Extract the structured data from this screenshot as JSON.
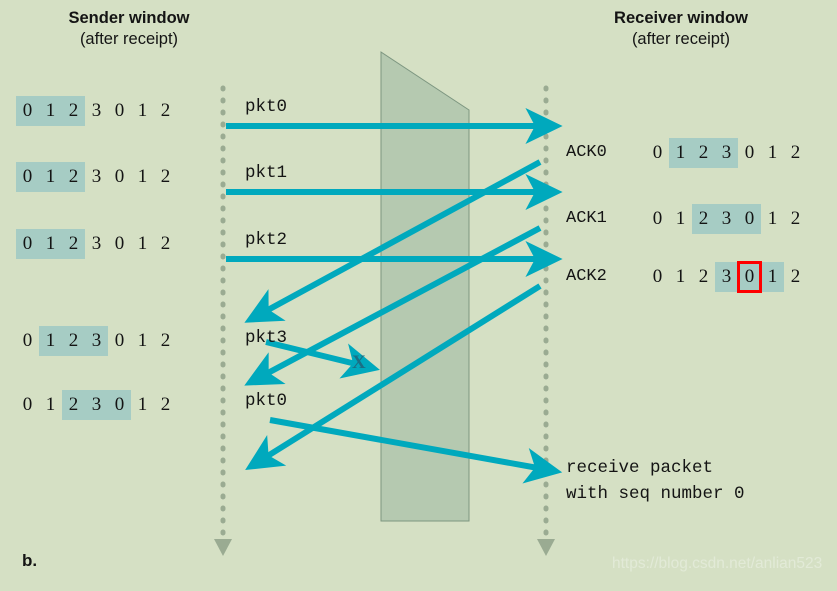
{
  "panel": {
    "letter": "b."
  },
  "watermark": {
    "text": "https://blog.csdn.net/anlian523"
  },
  "sender": {
    "title_line1": "Sender window",
    "title_line2": "(after receipt)",
    "windows": [
      {
        "cells": [
          "0",
          "1",
          "2",
          "3",
          "0",
          "1",
          "2"
        ],
        "highlight": [
          0,
          1,
          2
        ],
        "boxed": -1
      },
      {
        "cells": [
          "0",
          "1",
          "2",
          "3",
          "0",
          "1",
          "2"
        ],
        "highlight": [
          0,
          1,
          2
        ],
        "boxed": -1
      },
      {
        "cells": [
          "0",
          "1",
          "2",
          "3",
          "0",
          "1",
          "2"
        ],
        "highlight": [
          0,
          1,
          2
        ],
        "boxed": -1
      },
      {
        "cells": [
          "0",
          "1",
          "2",
          "3",
          "0",
          "1",
          "2"
        ],
        "highlight": [
          1,
          2,
          3
        ],
        "boxed": -1
      },
      {
        "cells": [
          "0",
          "1",
          "2",
          "3",
          "0",
          "1",
          "2"
        ],
        "highlight": [
          2,
          3,
          4
        ],
        "boxed": -1
      }
    ]
  },
  "receiver": {
    "title_line1": "Receiver window",
    "title_line2": "(after receipt)",
    "windows": [
      {
        "ack": "ACK0",
        "cells": [
          "0",
          "1",
          "2",
          "3",
          "0",
          "1",
          "2"
        ],
        "highlight": [
          1,
          2,
          3
        ],
        "boxed": -1
      },
      {
        "ack": "ACK1",
        "cells": [
          "0",
          "1",
          "2",
          "3",
          "0",
          "1",
          "2"
        ],
        "highlight": [
          2,
          3,
          4
        ],
        "boxed": -1
      },
      {
        "ack": "ACK2",
        "cells": [
          "0",
          "1",
          "2",
          "3",
          "0",
          "1",
          "2"
        ],
        "highlight": [
          3,
          4,
          5
        ],
        "boxed": 4
      }
    ]
  },
  "packets": [
    {
      "label": "pkt0"
    },
    {
      "label": "pkt1"
    },
    {
      "label": "pkt2"
    },
    {
      "label": "pkt3"
    },
    {
      "label": "pkt0"
    }
  ],
  "loss_marker": {
    "label": "X"
  },
  "note": {
    "line1": "receive packet",
    "line2": "with seq number 0"
  },
  "colors": {
    "background": "#d5e0c4",
    "arrow": "#00a9bd",
    "window_highlight": "#a6ccc4",
    "box_outline": "#ff0000",
    "timeline_dot": "#9aab92",
    "medium_fill": "#a9bfa8",
    "text": "#141414"
  }
}
